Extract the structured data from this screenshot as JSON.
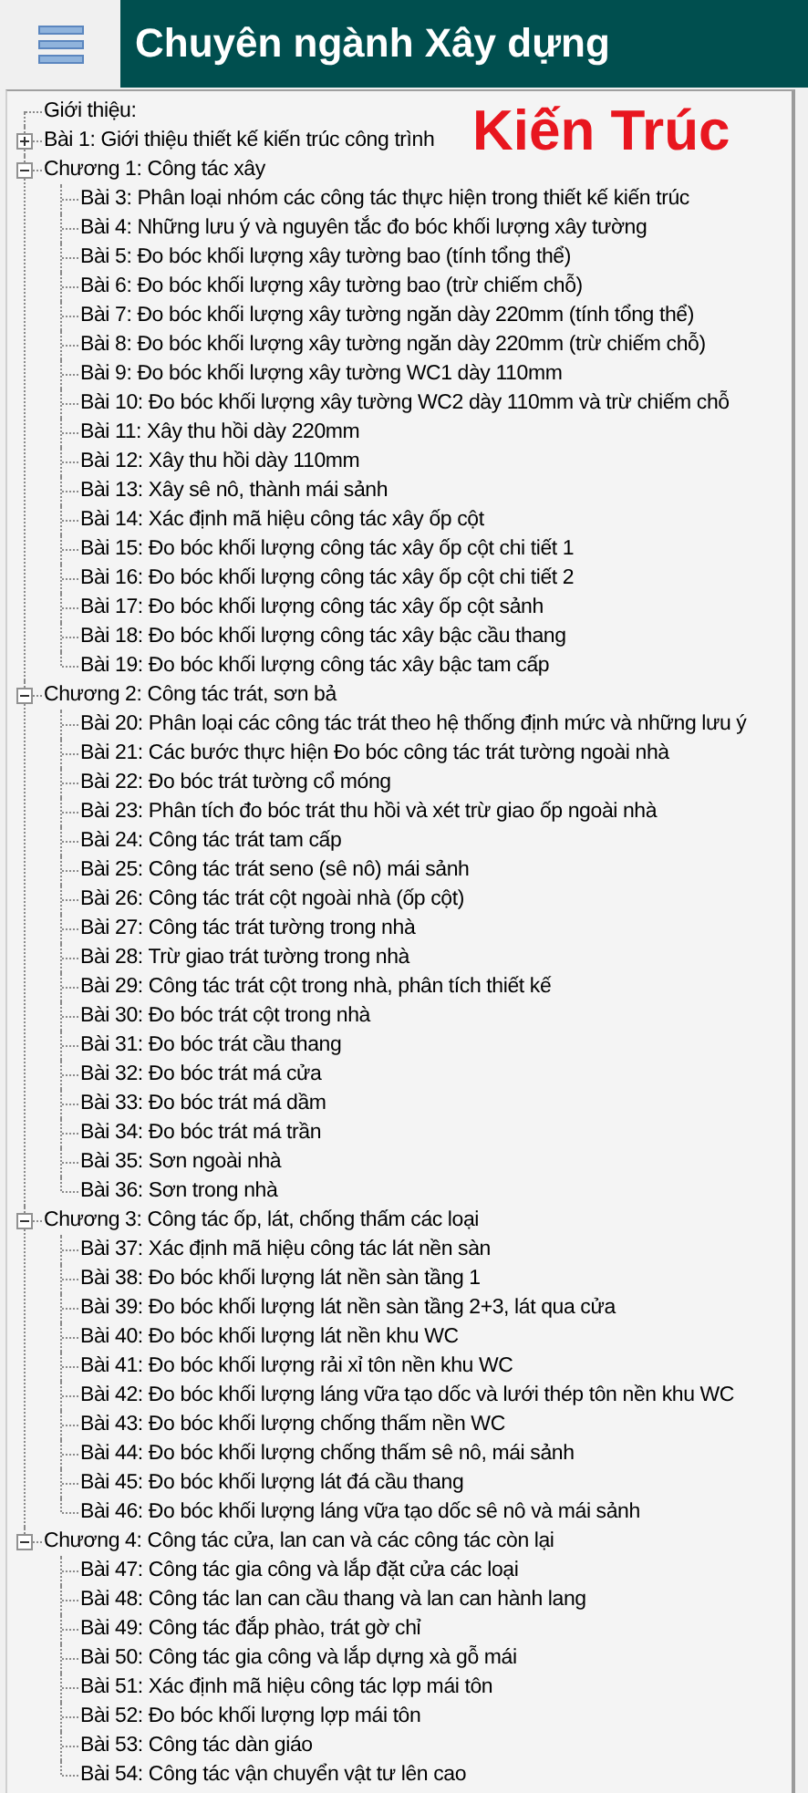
{
  "header": {
    "title": "Chuyên ngành Xây dựng"
  },
  "overlay_label": "Kiến Trúc",
  "tree": [
    {
      "label": "Giới thiệu:"
    },
    {
      "label": "Bài 1: Giới thiệu thiết kế kiến trúc công trình",
      "expanded": false
    },
    {
      "label": "Chương 1: Công tác xây",
      "expanded": true,
      "children": [
        {
          "label": "Bài 3: Phân loại nhóm các công tác thực hiện trong thiết kế kiến trúc"
        },
        {
          "label": "Bài 4: Những lưu ý và nguyên tắc đo bóc khối lượng xây tường"
        },
        {
          "label": "Bài 5: Đo bóc khối lượng xây tường bao (tính tổng thể)"
        },
        {
          "label": "Bài 6: Đo bóc khối lượng xây tường bao (trừ chiếm chỗ)"
        },
        {
          "label": "Bài 7: Đo bóc khối lượng xây tường ngăn dày 220mm (tính tổng thể)"
        },
        {
          "label": "Bài 8: Đo bóc khối lượng xây tường ngăn dày 220mm (trừ chiếm chỗ)"
        },
        {
          "label": "Bài 9: Đo bóc khối lượng xây tường WC1 dày 110mm"
        },
        {
          "label": "Bài 10: Đo bóc khối lượng xây tường WC2 dày 110mm và trừ chiếm chỗ"
        },
        {
          "label": "Bài 11: Xây thu hồi dày 220mm"
        },
        {
          "label": "Bài 12: Xây thu hồi dày 110mm"
        },
        {
          "label": "Bài 13: Xây sê nô, thành mái sảnh"
        },
        {
          "label": "Bài 14: Xác định mã hiệu công tác xây ốp cột"
        },
        {
          "label": "Bài 15: Đo bóc khối lượng công tác xây ốp cột chi tiết 1"
        },
        {
          "label": "Bài 16: Đo bóc khối lượng công tác xây ốp cột chi tiết 2"
        },
        {
          "label": "Bài 17: Đo bóc khối lượng công tác xây ốp cột sảnh"
        },
        {
          "label": "Bài 18: Đo bóc khối lượng công tác xây bậc cầu thang"
        },
        {
          "label": "Bài 19: Đo bóc khối lượng công tác xây bậc tam cấp"
        }
      ]
    },
    {
      "label": "Chương 2: Công tác trát, sơn bả",
      "expanded": true,
      "children": [
        {
          "label": "Bài 20: Phân loại các công tác trát theo hệ thống định mức và những lưu ý"
        },
        {
          "label": "Bài 21: Các bước thực hiện Đo bóc công tác trát tường ngoài nhà"
        },
        {
          "label": "Bài 22: Đo bóc trát tường cổ móng"
        },
        {
          "label": "Bài 23: Phân tích đo bóc trát thu hồi và xét trừ giao ốp ngoài nhà"
        },
        {
          "label": "Bài 24: Công tác trát tam cấp"
        },
        {
          "label": "Bài 25: Công tác trát seno (sê nô) mái sảnh"
        },
        {
          "label": "Bài 26: Công tác trát cột ngoài nhà (ốp cột)"
        },
        {
          "label": "Bài 27: Công tác trát tường trong nhà"
        },
        {
          "label": "Bài 28: Trừ giao trát tường trong nhà"
        },
        {
          "label": "Bài 29: Công tác trát cột trong nhà, phân tích thiết kế"
        },
        {
          "label": "Bài 30: Đo bóc trát cột trong nhà"
        },
        {
          "label": "Bài 31: Đo bóc trát cầu thang"
        },
        {
          "label": "Bài 32: Đo bóc trát má cửa"
        },
        {
          "label": "Bài 33: Đo bóc trát má dầm"
        },
        {
          "label": "Bài 34: Đo bóc trát má trần"
        },
        {
          "label": "Bài 35: Sơn ngoài nhà"
        },
        {
          "label": "Bài 36: Sơn trong nhà"
        }
      ]
    },
    {
      "label": "Chương 3: Công tác ốp, lát, chống thấm các loại",
      "expanded": true,
      "children": [
        {
          "label": "Bài 37: Xác định mã hiệu công tác lát nền sàn"
        },
        {
          "label": "Bài 38: Đo bóc khối lượng lát nền sàn tầng 1"
        },
        {
          "label": "Bài 39: Đo bóc khối lượng lát nền sàn tầng 2+3, lát qua cửa"
        },
        {
          "label": "Bài 40: Đo bóc khối lượng lát nền khu WC"
        },
        {
          "label": "Bài 41: Đo bóc khối lượng rải xỉ tôn nền khu WC"
        },
        {
          "label": "Bài 42: Đo bóc khối lượng láng vữa tạo dốc và lưới thép tôn nền khu WC"
        },
        {
          "label": "Bài 43: Đo bóc khối lượng chống thấm nền WC"
        },
        {
          "label": "Bài 44: Đo bóc khối lượng chống thấm sê nô, mái sảnh"
        },
        {
          "label": "Bài 45: Đo bóc khối lượng lát đá cầu thang"
        },
        {
          "label": "Bài 46: Đo bóc khối lượng láng vữa tạo dốc sê nô và mái sảnh"
        }
      ]
    },
    {
      "label": "Chương 4: Công tác cửa, lan can và các công tác còn lại",
      "expanded": true,
      "children": [
        {
          "label": "Bài 47: Công tác gia công và lắp đặt cửa các loại"
        },
        {
          "label": "Bài 48: Công tác lan can cầu thang và lan can hành lang"
        },
        {
          "label": "Bài 49: Công tác đắp phào, trát gờ chỉ"
        },
        {
          "label": "Bài 50: Công tác gia công và lắp dựng xà gỗ mái"
        },
        {
          "label": "Bài 51: Xác định mã hiệu công tác lợp mái tôn"
        },
        {
          "label": "Bài 52: Đo bóc khối lượng lợp mái tôn"
        },
        {
          "label": "Bài 53: Công tác dàn giáo"
        },
        {
          "label": "Bài 54: Công tác vận chuyển vật tư lên cao"
        }
      ]
    }
  ]
}
